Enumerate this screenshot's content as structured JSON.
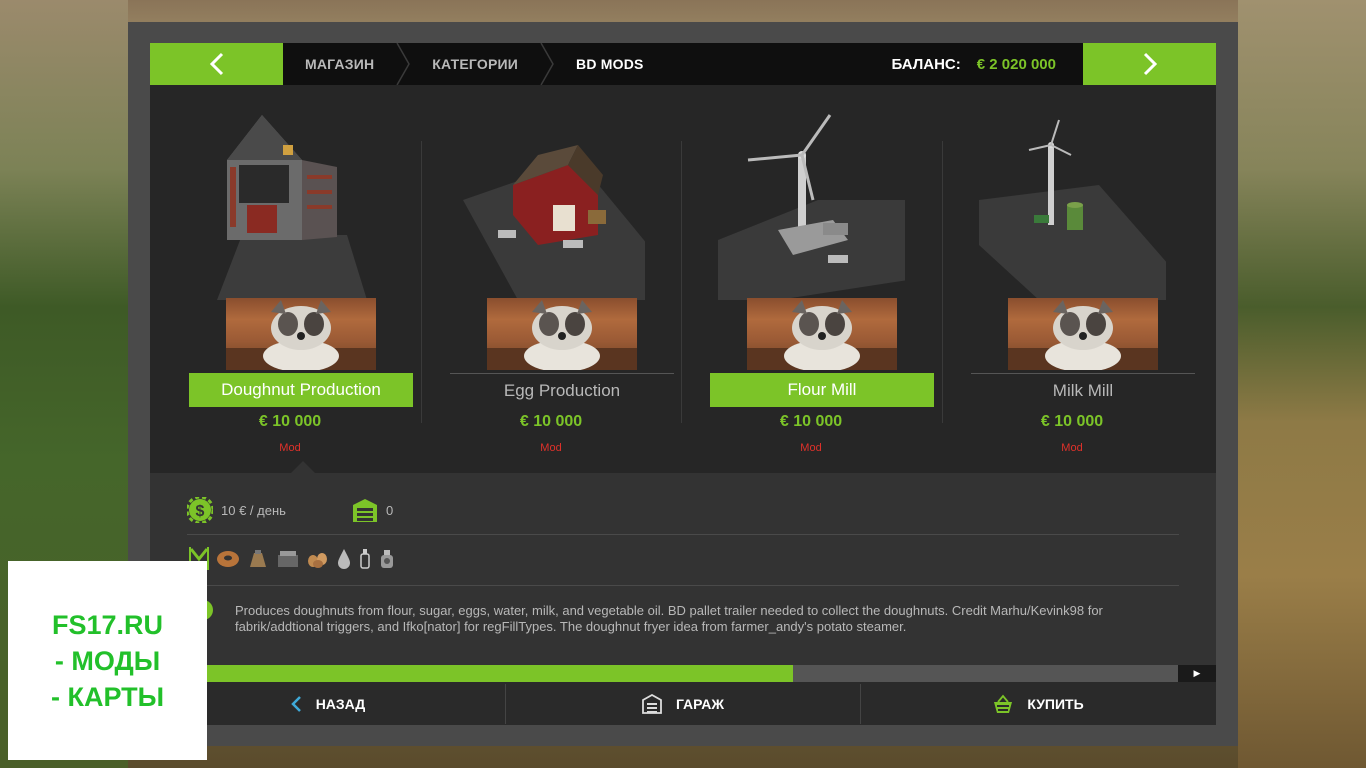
{
  "breadcrumb": [
    "МАГАЗИН",
    "КАТЕГОРИИ",
    "BD MODS"
  ],
  "balance": {
    "label": "БАЛАНС:",
    "value": "€ 2 020 000"
  },
  "items": [
    {
      "name": "Doughnut Production",
      "price": "€ 10 000",
      "tag": "Mod",
      "selected": true
    },
    {
      "name": "Egg Production",
      "price": "€ 10 000",
      "tag": "Mod",
      "selected": false
    },
    {
      "name": "Flour Mill",
      "price": "€ 10 000",
      "tag": "Mod",
      "selected": true
    },
    {
      "name": "Milk Mill",
      "price": "€ 10 000",
      "tag": "Mod",
      "selected": false
    }
  ],
  "details": {
    "upkeep": "10 € / день",
    "capacity": "0",
    "fill_icons": [
      "doughnut-icon",
      "flour-icon",
      "sugar-icon",
      "eggs-icon",
      "water-icon",
      "milk-icon",
      "oil-icon"
    ],
    "description": "Produces doughnuts from flour, sugar, eggs, water, milk, and vegetable oil. BD pallet trailer needed to collect the doughnuts. Credit Marhu/Kevink98 for fabrik/addtional triggers, and Ifko[nator] for regFillTypes. The doughnut fryer idea from farmer_andy's potato steamer."
  },
  "scroll_progress": 0.625,
  "buttons": {
    "back": "НАЗАД",
    "garage": "ГАРАЖ",
    "buy": "КУПИТЬ"
  },
  "watermark": [
    "FS17.RU",
    "- МОДЫ",
    "- КАРТЫ"
  ],
  "colors": {
    "accent": "#7cc428",
    "mod_tag": "#e0312a"
  }
}
